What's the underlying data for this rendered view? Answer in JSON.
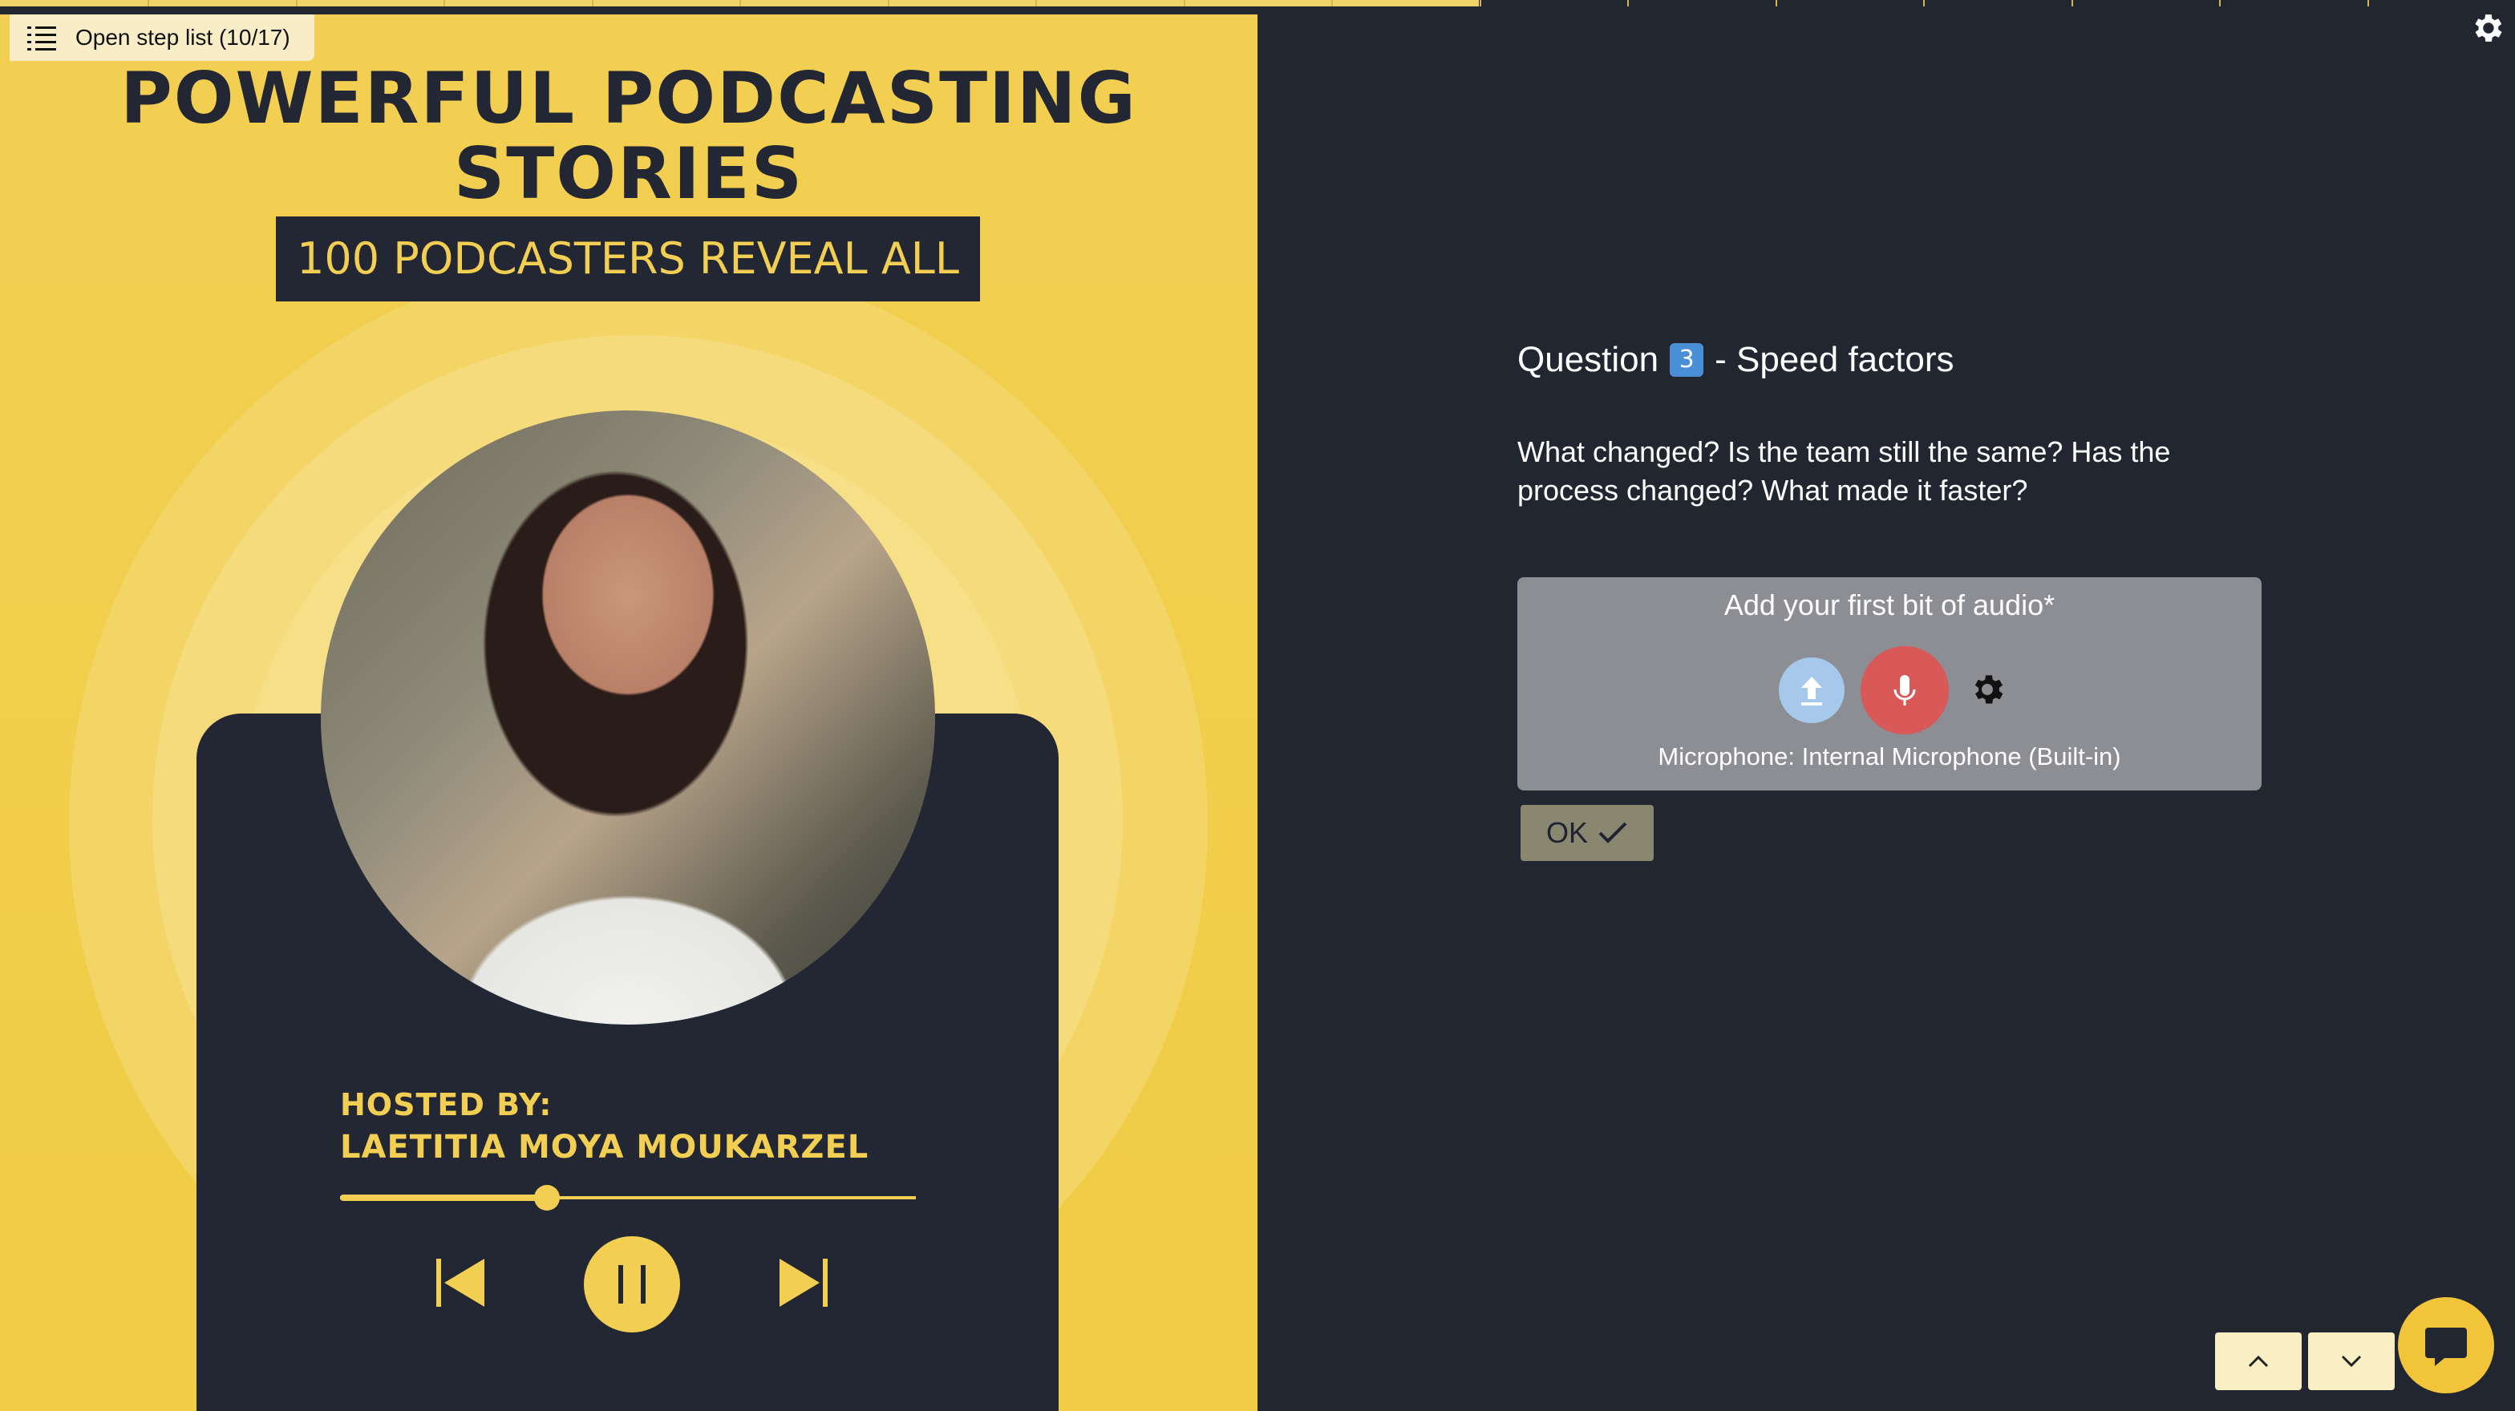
{
  "step_list": {
    "label": "Open step list (10/17)"
  },
  "progress": {
    "fraction": 0.588,
    "steps_done": 10,
    "steps_total": 17
  },
  "cover": {
    "title_line1": "POWERFUL PODCASTING",
    "title_line2": "STORIES",
    "banner": "100 PODCASTERS REVEAL ALL",
    "hosted_by": "HOSTED BY:",
    "host_name": "LAETITIA MOYA MOUKARZEL",
    "playback_fraction": 0.36
  },
  "question": {
    "title_prefix": "Question",
    "number_emoji": "3",
    "title_suffix": "- Speed factors",
    "body": "What changed? Is the team still the same? Has the process changed? What made it faster?"
  },
  "audio": {
    "title": "Add your first bit of audio*",
    "microphone_label": "Microphone: Internal Microphone (Built-in)",
    "icons": [
      "upload-icon",
      "microphone-icon",
      "gear-icon"
    ]
  },
  "ok_button": {
    "label": "OK"
  },
  "colors": {
    "background": "#222631",
    "cover_yellow": "#f2cf52",
    "record_red": "#d95858",
    "upload_blue": "#a6c8ea",
    "nav_button": "#faeec4",
    "chat_button": "#f2c439"
  }
}
